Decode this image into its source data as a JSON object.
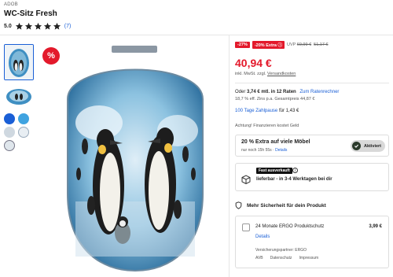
{
  "product": {
    "brand": "ADOB",
    "title": "WC-Sitz Fresh",
    "rating_score": "5.0",
    "rating_count": "(7)",
    "stars": 5
  },
  "gallery": {
    "sale_badge": "%"
  },
  "pricing": {
    "discount_badge": "-27%",
    "extra_badge": "-20% Extra",
    "extra_info_icon": "info-icon",
    "uvp_label": "UVP",
    "uvp_old": "69,99 €",
    "prev_price": "51,17 €",
    "price": "40,94 €",
    "tax_prefix": "inkl. MwSt. zzgl. ",
    "tax_link": "Versandkosten"
  },
  "installments": {
    "text_prefix": "Oder ",
    "text_bold": "3,74 € mtl. in 12 Raten",
    "calc_link": "Zum Ratenrechner",
    "interest": "18,7 % eff. Zins p.a. Gesamtpreis 44,87 €",
    "pay_link": "100 Tage Zahlpause",
    "pay_suffix": " für 1,43 €",
    "note": "Achtung! Finanzieren kostet Geld"
  },
  "extra": {
    "title": "20 % Extra auf viele Möbel",
    "timer": "nur noch 15h 55s · ",
    "details_link": "Details",
    "toggle_label": "Aktiviert"
  },
  "shipping": {
    "tag": "Fast ausverkauft",
    "text": "lieferbar - in 3-4 Werktagen bei dir"
  },
  "protection": {
    "heading": "Mehr Sicherheit für dein Produkt",
    "name": "24 Monate ERGO Produktschutz",
    "price": "3,99 €",
    "details_link": "Details",
    "partner": "Versicherungspartner: ERGO",
    "links": [
      "AVB",
      "Datenschutz",
      "Impressum"
    ]
  },
  "colors": {
    "accent": "#1a5fd6",
    "sale": "#e3192b"
  }
}
